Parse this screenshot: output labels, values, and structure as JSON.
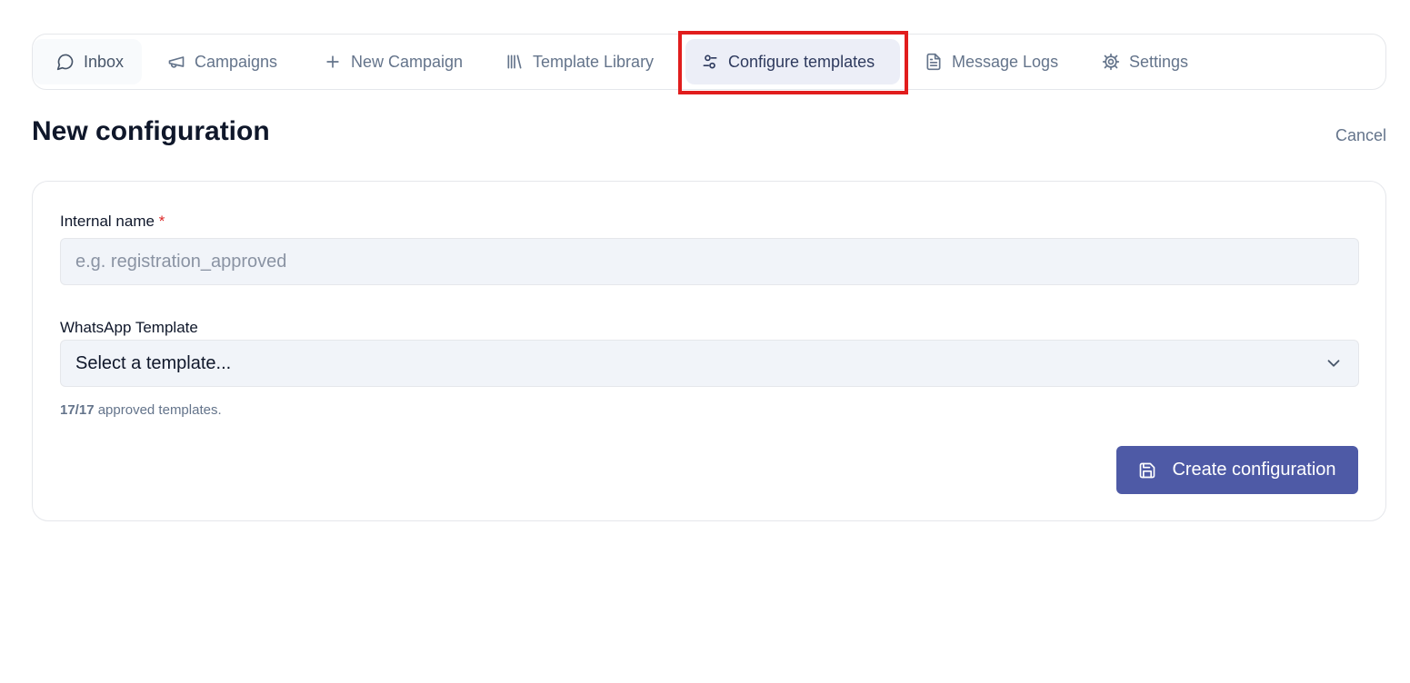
{
  "nav": {
    "items": [
      {
        "label": "Inbox",
        "icon": "chat-bubble-icon"
      },
      {
        "label": "Campaigns",
        "icon": "megaphone-icon"
      },
      {
        "label": "New Campaign",
        "icon": "plus-icon"
      },
      {
        "label": "Template Library",
        "icon": "library-icon"
      },
      {
        "label": "Configure templates",
        "icon": "sliders-icon"
      },
      {
        "label": "Message Logs",
        "icon": "document-icon"
      },
      {
        "label": "Settings",
        "icon": "gear-icon"
      }
    ],
    "active": "Configure templates"
  },
  "header": {
    "title": "New configuration",
    "cancel_label": "Cancel"
  },
  "form": {
    "internal_name": {
      "label": "Internal name",
      "required_mark": "*",
      "value": "",
      "placeholder": "e.g. registration_approved"
    },
    "whatsapp_template": {
      "label": "WhatsApp Template",
      "selected": "Select a template...",
      "hint_count": "17/17",
      "hint_text": " approved templates."
    },
    "submit_label": "Create configuration"
  },
  "colors": {
    "primary": "#4e5aa6",
    "active_tab_bg": "#eceef7",
    "required": "#dc2626",
    "highlight": "#e11d1d"
  }
}
